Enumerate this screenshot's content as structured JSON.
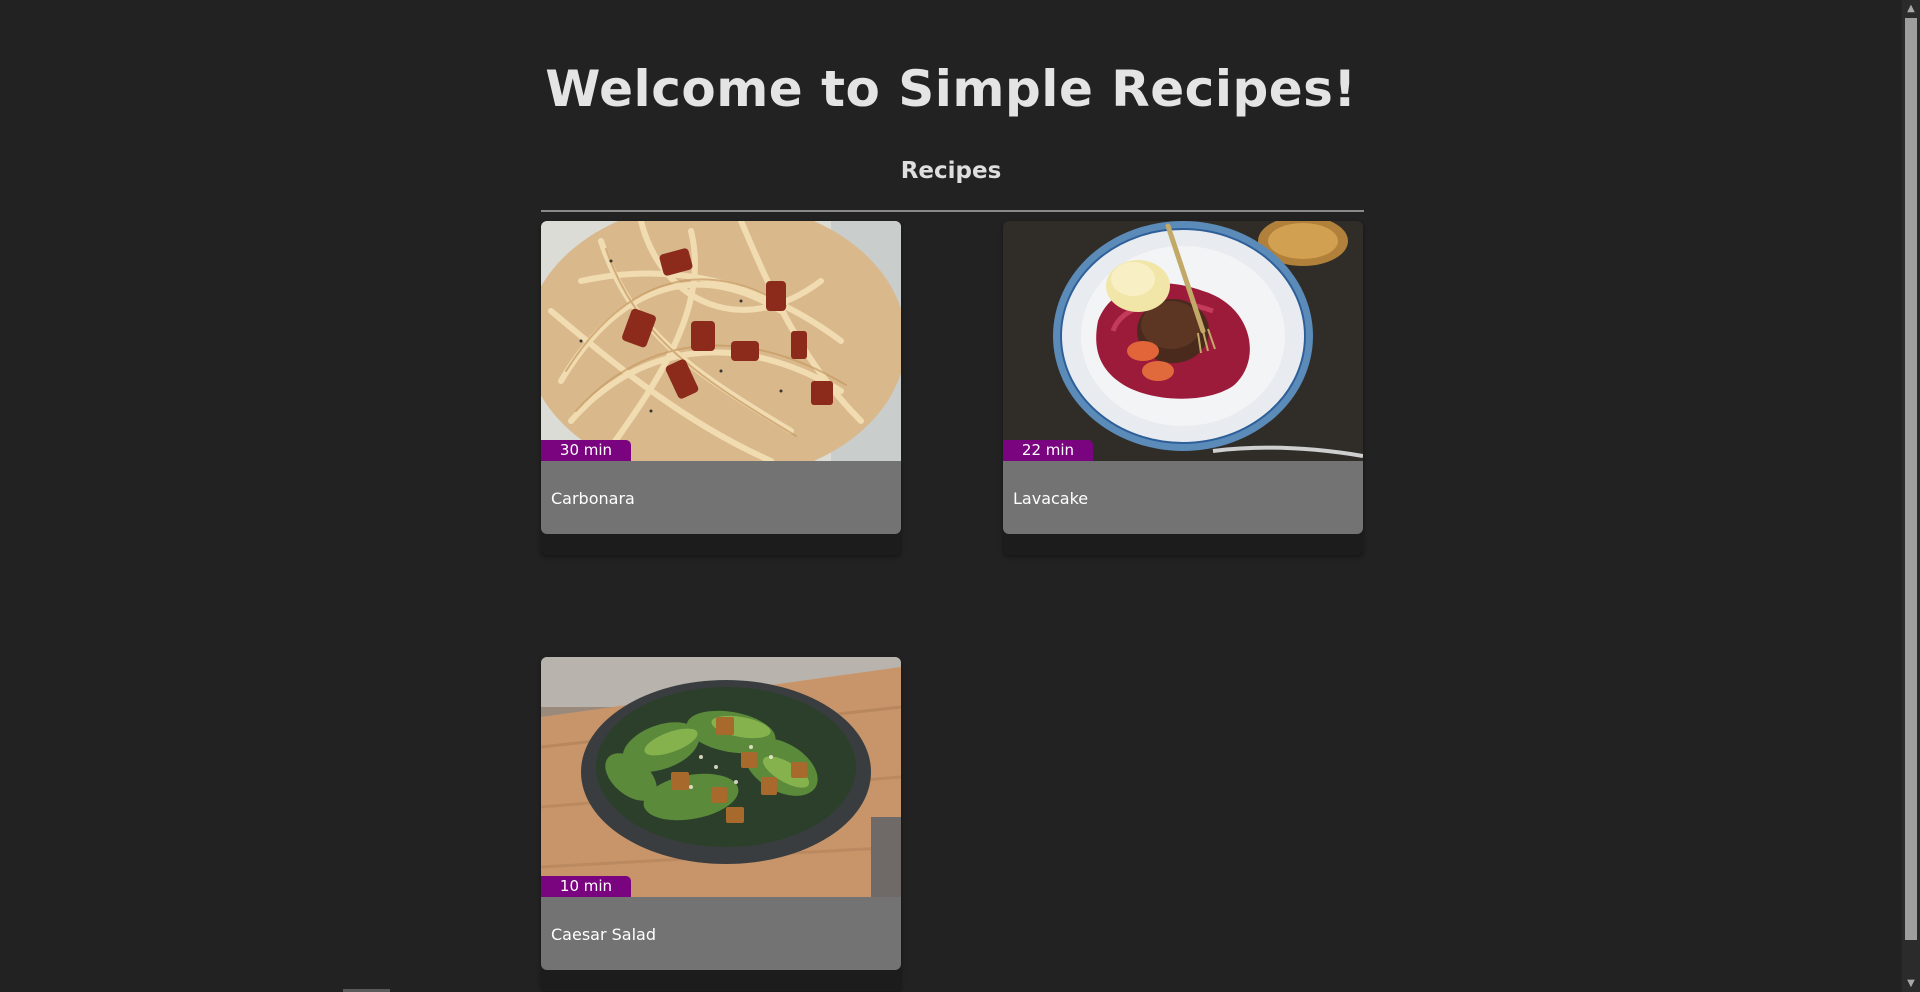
{
  "header": {
    "title": "Welcome to Simple Recipes!",
    "section_heading": "Recipes"
  },
  "recipes": [
    {
      "name": "Carbonara",
      "time": "30 min",
      "image": "carbonara-pasta-photo"
    },
    {
      "name": "Lavacake",
      "time": "22 min",
      "image": "lava-cake-plate-photo"
    },
    {
      "name": "Caesar Salad",
      "time": "10 min",
      "image": "caesar-salad-bowl-photo"
    }
  ],
  "colors": {
    "background": "#222222",
    "badge": "#7a0480",
    "card_body": "#737373",
    "title_text": "#e4e4e4"
  },
  "scrollbar": {
    "up_icon": "chevron-up-icon",
    "down_icon": "chevron-down-icon"
  }
}
